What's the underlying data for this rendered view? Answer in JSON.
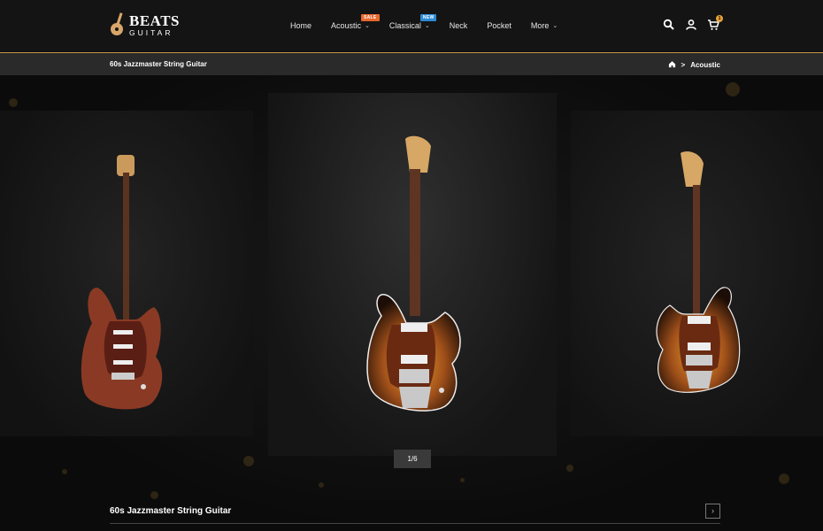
{
  "brand": {
    "title": "BEATS",
    "subtitle": "GUITAR"
  },
  "nav": [
    {
      "label": "Home",
      "has_dropdown": false
    },
    {
      "label": "Acoustic",
      "has_dropdown": true,
      "badge": "SALE",
      "badge_color": "#e8682e"
    },
    {
      "label": "Classical",
      "has_dropdown": true,
      "badge": "NEW",
      "badge_color": "#2b8bd6"
    },
    {
      "label": "Neck",
      "has_dropdown": false
    },
    {
      "label": "Pocket",
      "has_dropdown": false
    },
    {
      "label": "More",
      "has_dropdown": true
    }
  ],
  "header_icons": {
    "search": "search-icon",
    "account": "user-icon",
    "cart": "cart-icon",
    "cart_count": "1"
  },
  "breadcrumb": {
    "page_title": "60s Jazzmaster String Guitar",
    "home_icon": "home-icon",
    "separator": ">",
    "current": "Acoustic"
  },
  "gallery": {
    "counter": "1/6",
    "slides": [
      {
        "name": "red-stratocaster",
        "body_color": "#8a3a24"
      },
      {
        "name": "sunburst-jazzmaster",
        "body_color": "#c8781c"
      },
      {
        "name": "sunburst-jazzmaster-lefty",
        "body_color": "#c8781c"
      }
    ]
  },
  "product": {
    "title": "60s Jazzmaster String Guitar",
    "next_icon": "chevron-right-icon"
  },
  "colors": {
    "accent": "#c8964a",
    "header_bg": "#141414",
    "bar_bg": "#2a2a2a"
  }
}
